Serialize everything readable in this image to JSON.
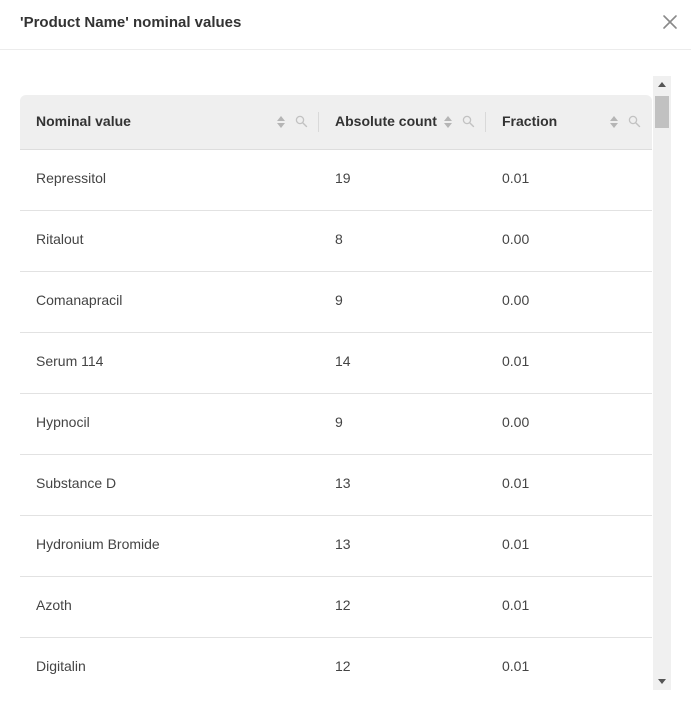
{
  "dialog": {
    "title": "'Product Name' nominal values"
  },
  "icons": {
    "close": "close-icon",
    "sort": "sort-icon",
    "search": "search-icon"
  },
  "colors": {
    "header_bg": "#efefef",
    "scrollbar_track": "#f0f0f0",
    "scrollbar_thumb": "#c1c1c1"
  },
  "table": {
    "columns": [
      {
        "label": "Nominal value"
      },
      {
        "label": "Absolute count"
      },
      {
        "label": "Fraction"
      }
    ],
    "rows": [
      {
        "name": "Repressitol",
        "count": "19",
        "fraction": "0.01"
      },
      {
        "name": "Ritalout",
        "count": "8",
        "fraction": "0.00"
      },
      {
        "name": "Comanapracil",
        "count": "9",
        "fraction": "0.00"
      },
      {
        "name": "Serum 114",
        "count": "14",
        "fraction": "0.01"
      },
      {
        "name": "Hypnocil",
        "count": "9",
        "fraction": "0.00"
      },
      {
        "name": "Substance D",
        "count": "13",
        "fraction": "0.01"
      },
      {
        "name": "Hydronium Bromide",
        "count": "13",
        "fraction": "0.01"
      },
      {
        "name": "Azoth",
        "count": "12",
        "fraction": "0.01"
      },
      {
        "name": "Digitalin",
        "count": "12",
        "fraction": "0.01"
      }
    ]
  }
}
